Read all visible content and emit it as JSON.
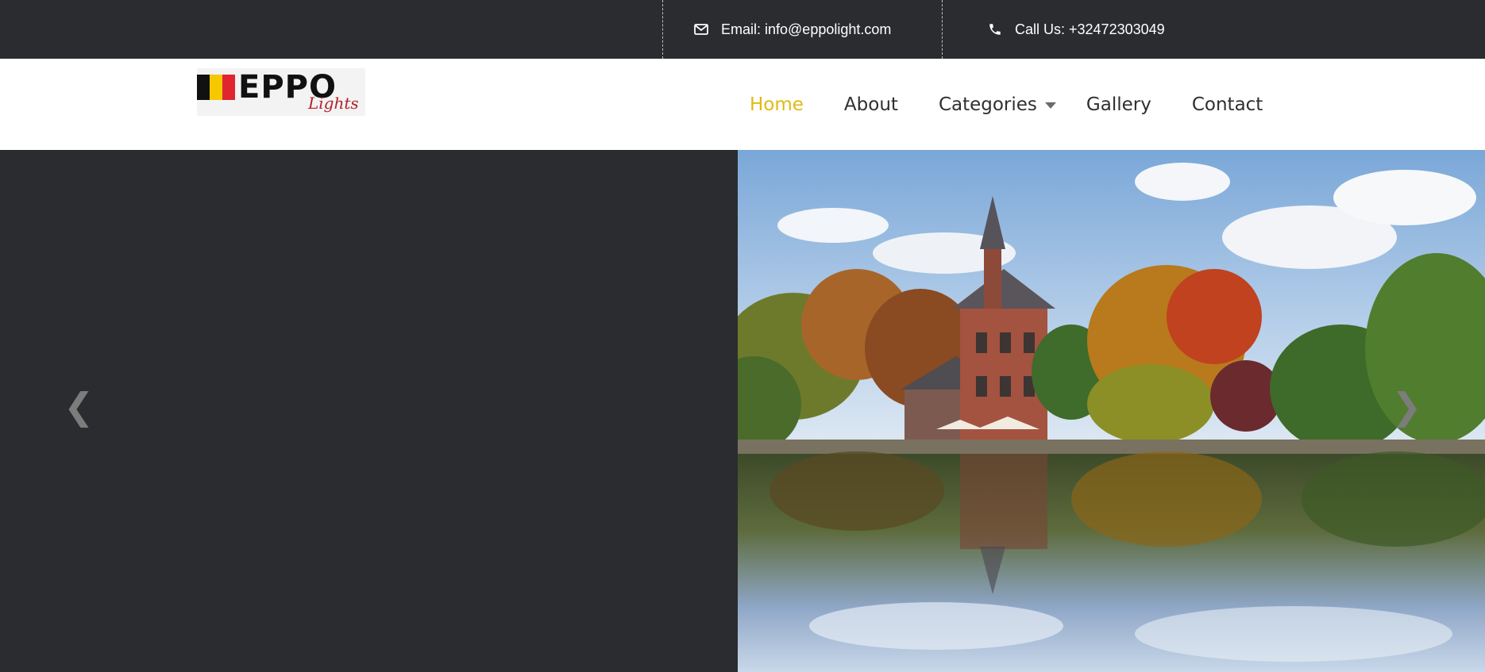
{
  "topbar": {
    "email_icon": "envelope-icon",
    "email_text": "Email: info@eppolight.com",
    "phone_icon": "phone-icon",
    "phone_text": "Call Us: +32472303049"
  },
  "header": {
    "logo": {
      "brand": "EPPO",
      "subtitle": "Lights",
      "flag_colors": [
        "#111111",
        "#f5c800",
        "#e0252f"
      ]
    },
    "nav": [
      {
        "label": "Home",
        "active": true
      },
      {
        "label": "About",
        "active": false
      },
      {
        "label": "Categories",
        "active": false,
        "has_dropdown": true
      },
      {
        "label": "Gallery",
        "active": false
      },
      {
        "label": "Contact",
        "active": false
      }
    ]
  },
  "hero": {
    "prev_symbol": "❮",
    "next_symbol": "❯",
    "image_subject": "castle-by-lake-photo"
  },
  "colors": {
    "dark_bg": "#2b2c2f",
    "accent": "#e2b814",
    "nav_text": "#2f2f2f"
  }
}
